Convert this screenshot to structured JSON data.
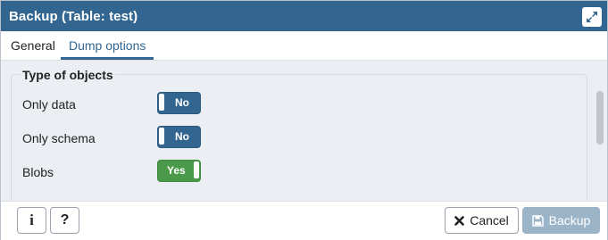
{
  "dialog": {
    "title": "Backup (Table: test)"
  },
  "tabs": [
    {
      "label": "General"
    },
    {
      "label": "Dump options"
    }
  ],
  "section": {
    "legend": "Type of objects",
    "rows": [
      {
        "label": "Only data",
        "toggle": "No"
      },
      {
        "label": "Only schema",
        "toggle": "No"
      },
      {
        "label": "Blobs",
        "toggle": "Yes"
      }
    ]
  },
  "footer": {
    "info": "i",
    "help": "?",
    "cancel": "Cancel",
    "backup": "Backup"
  },
  "colors": {
    "header": "#326690",
    "toggle_off": "#326690",
    "toggle_on": "#4a9a4a",
    "backup_disabled": "#9cb4c8"
  },
  "icons": {
    "maximize": "expand-icon",
    "cancel": "close-icon",
    "backup": "save-icon"
  }
}
